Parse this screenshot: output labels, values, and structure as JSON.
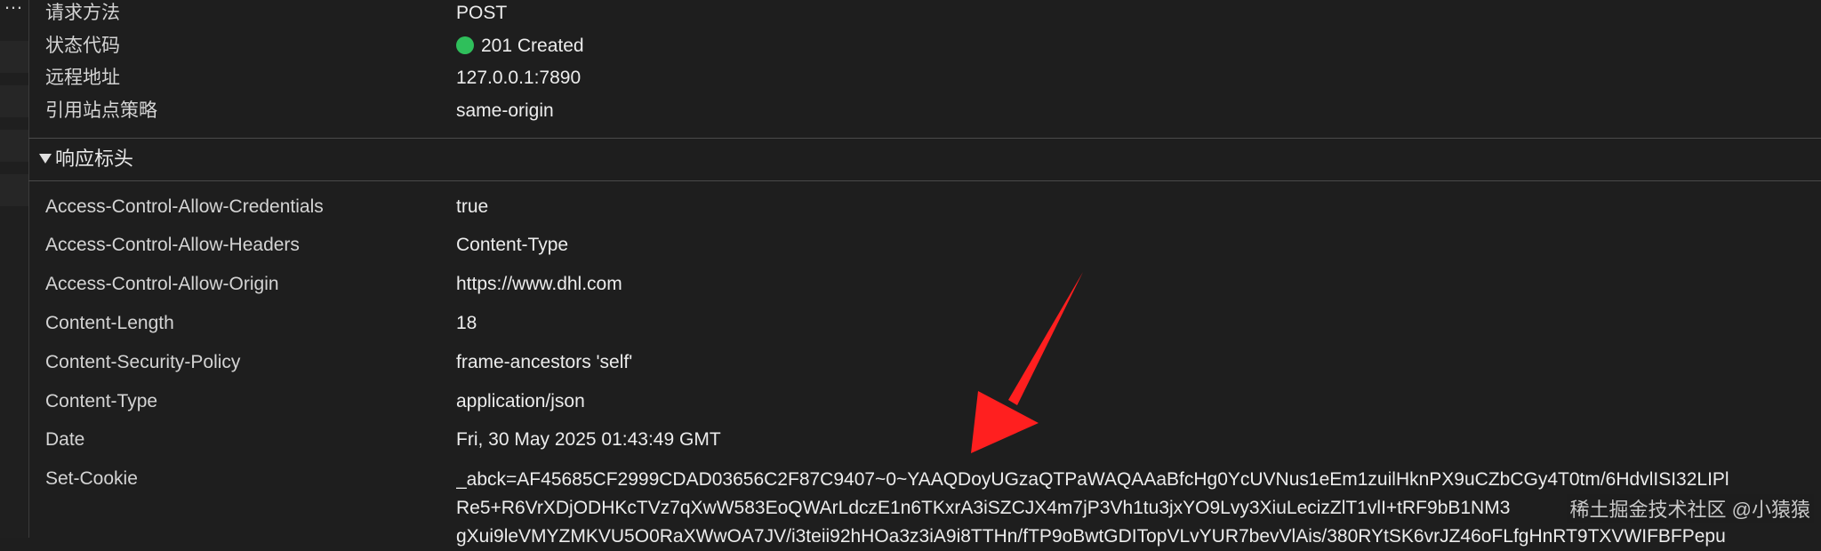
{
  "general": {
    "rows": [
      {
        "key": "请求方法",
        "value": "POST"
      },
      {
        "key": "状态代码",
        "value": "201 Created"
      },
      {
        "key": "远程地址",
        "value": "127.0.0.1:7890"
      },
      {
        "key": "引用站点策略",
        "value": "same-origin"
      }
    ]
  },
  "response_headers": {
    "title": "响应标头",
    "rows": [
      {
        "key": "Access-Control-Allow-Credentials",
        "value": "true"
      },
      {
        "key": "Access-Control-Allow-Headers",
        "value": "Content-Type"
      },
      {
        "key": "Access-Control-Allow-Origin",
        "value": "https://www.dhl.com"
      },
      {
        "key": "Content-Length",
        "value": "18"
      },
      {
        "key": "Content-Security-Policy",
        "value": "frame-ancestors 'self'"
      },
      {
        "key": "Content-Type",
        "value": "application/json"
      },
      {
        "key": "Date",
        "value": "Fri, 30 May 2025 01:43:49 GMT"
      },
      {
        "key": "Set-Cookie",
        "value_lines": [
          "_abck=AF45685CF2999CDAD03656C2F87C9407~0~YAAQDoyUGzaQTPaWAQAAaBfcHg0YcUVNus1eEm1zuilHknPX9uCZbCGy4T0tm/6HdvlISI32LIPl",
          "Re5+R6VrXDjODHKcTVz7qXwW583EoQWArLdczE1n6TKxrA3iSZCJX4m7jP3Vh1tu3jxYO9Lvy3XiuLecizZlT1vlI+tRF9bB1NM3",
          "gXui9leVMYZMKVU5O0RaXWwOA7JV/i3teii92hHOa3z3iA9i8TTHn/fTP9oBwtGDITopVLvYUR7bevVlAis/380RYtSK6vrJZ46oFLfgHnRT9TXVWIFBFPepu"
        ]
      }
    ]
  },
  "watermark": "稀土掘金技术社区 @小猿猿"
}
